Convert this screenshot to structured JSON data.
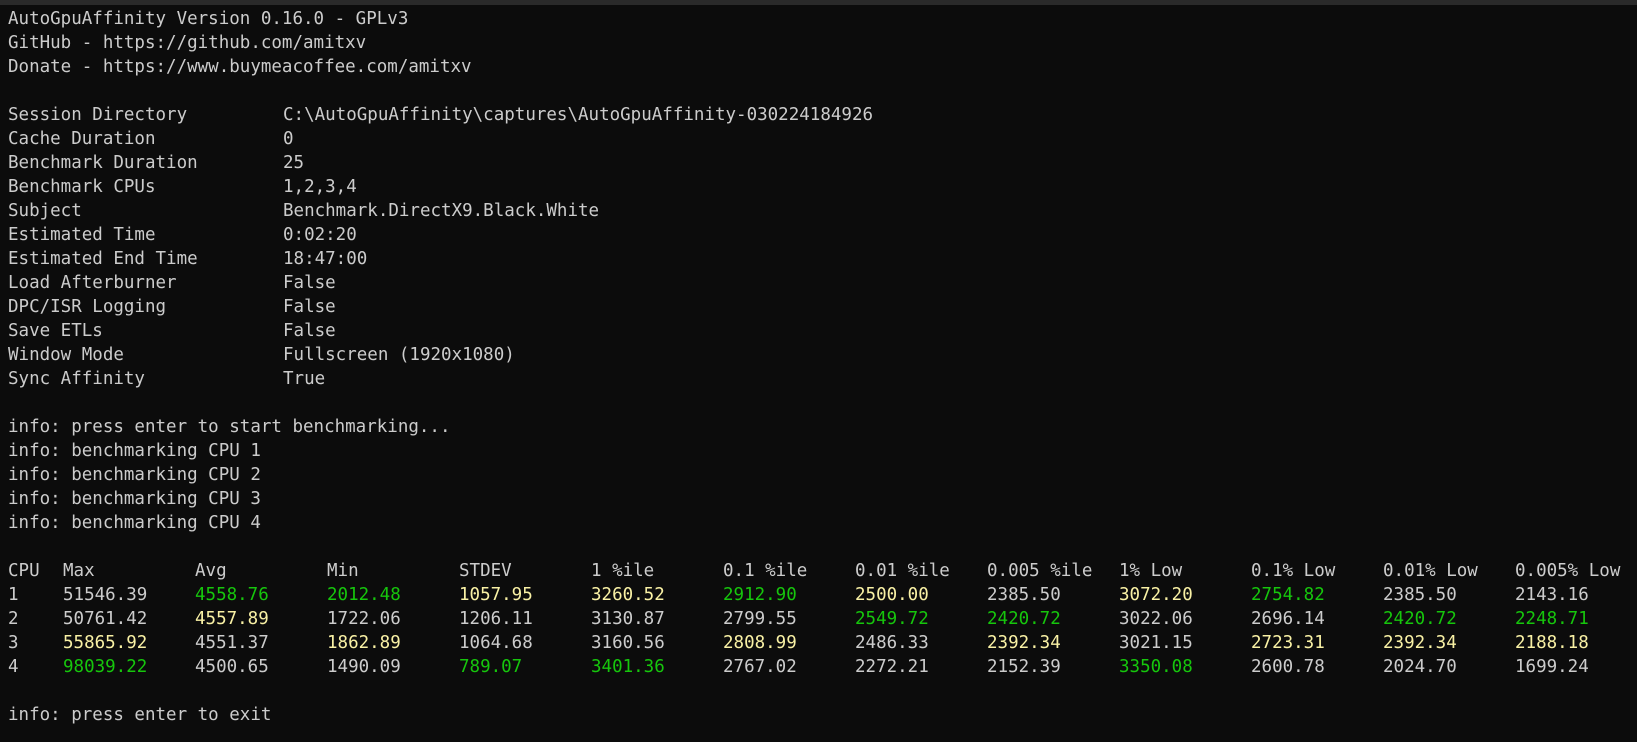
{
  "header": {
    "title": "AutoGpuAffinity Version 0.16.0 - GPLv3",
    "github": "GitHub - https://github.com/amitxv",
    "donate": "Donate - https://www.buymeacoffee.com/amitxv"
  },
  "config": [
    {
      "key": "Session Directory",
      "value": "C:\\AutoGpuAffinity\\captures\\AutoGpuAffinity-030224184926"
    },
    {
      "key": "Cache Duration",
      "value": "0"
    },
    {
      "key": "Benchmark Duration",
      "value": "25"
    },
    {
      "key": "Benchmark CPUs",
      "value": "1,2,3,4"
    },
    {
      "key": "Subject",
      "value": "Benchmark.DirectX9.Black.White"
    },
    {
      "key": "Estimated Time",
      "value": "0:02:20"
    },
    {
      "key": "Estimated End Time",
      "value": "18:47:00"
    },
    {
      "key": "Load Afterburner",
      "value": "False"
    },
    {
      "key": "DPC/ISR Logging",
      "value": "False"
    },
    {
      "key": "Save ETLs",
      "value": "False"
    },
    {
      "key": "Window Mode",
      "value": "Fullscreen (1920x1080)"
    },
    {
      "key": "Sync Affinity",
      "value": "True"
    }
  ],
  "log": [
    "info: press enter to start benchmarking...",
    "info: benchmarking CPU 1",
    "info: benchmarking CPU 2",
    "info: benchmarking CPU 3",
    "info: benchmarking CPU 4"
  ],
  "table": {
    "headers": [
      "CPU",
      "Max",
      "Avg",
      "Min",
      "STDEV",
      "1 %ile",
      "0.1 %ile",
      "0.01 %ile",
      "0.005 %ile",
      "1% Low",
      "0.1% Low",
      "0.01% Low",
      "0.005% Low"
    ],
    "rows": [
      {
        "cells": [
          "1",
          "51546.39",
          "4558.76",
          "2012.48",
          "1057.95",
          "3260.52",
          "2912.90",
          "2500.00",
          "2385.50",
          "3072.20",
          "2754.82",
          "2385.50",
          "2143.16"
        ],
        "colors": [
          "default",
          "default",
          "green",
          "green",
          "yellow",
          "yellow",
          "green",
          "yellow",
          "default",
          "yellow",
          "green",
          "default",
          "default"
        ]
      },
      {
        "cells": [
          "2",
          "50761.42",
          "4557.89",
          "1722.06",
          "1206.11",
          "3130.87",
          "2799.55",
          "2549.72",
          "2420.72",
          "3022.06",
          "2696.14",
          "2420.72",
          "2248.71"
        ],
        "colors": [
          "default",
          "default",
          "yellow",
          "default",
          "default",
          "default",
          "default",
          "green",
          "green",
          "default",
          "default",
          "green",
          "green"
        ]
      },
      {
        "cells": [
          "3",
          "55865.92",
          "4551.37",
          "1862.89",
          "1064.68",
          "3160.56",
          "2808.99",
          "2486.33",
          "2392.34",
          "3021.15",
          "2723.31",
          "2392.34",
          "2188.18"
        ],
        "colors": [
          "default",
          "yellow",
          "default",
          "yellow",
          "default",
          "default",
          "yellow",
          "default",
          "yellow",
          "default",
          "yellow",
          "yellow",
          "yellow"
        ]
      },
      {
        "cells": [
          "4",
          "98039.22",
          "4500.65",
          "1490.09",
          "789.07",
          "3401.36",
          "2767.02",
          "2272.21",
          "2152.39",
          "3350.08",
          "2600.78",
          "2024.70",
          "1699.24"
        ],
        "colors": [
          "default",
          "green",
          "default",
          "default",
          "green",
          "green",
          "default",
          "default",
          "default",
          "green",
          "default",
          "default",
          "default"
        ]
      }
    ]
  },
  "footer": "info: press enter to exit",
  "colors": {
    "background": "#0c0c0c",
    "text": "#cccccc",
    "green": "#16c60c",
    "yellow": "#f9f1a5"
  }
}
